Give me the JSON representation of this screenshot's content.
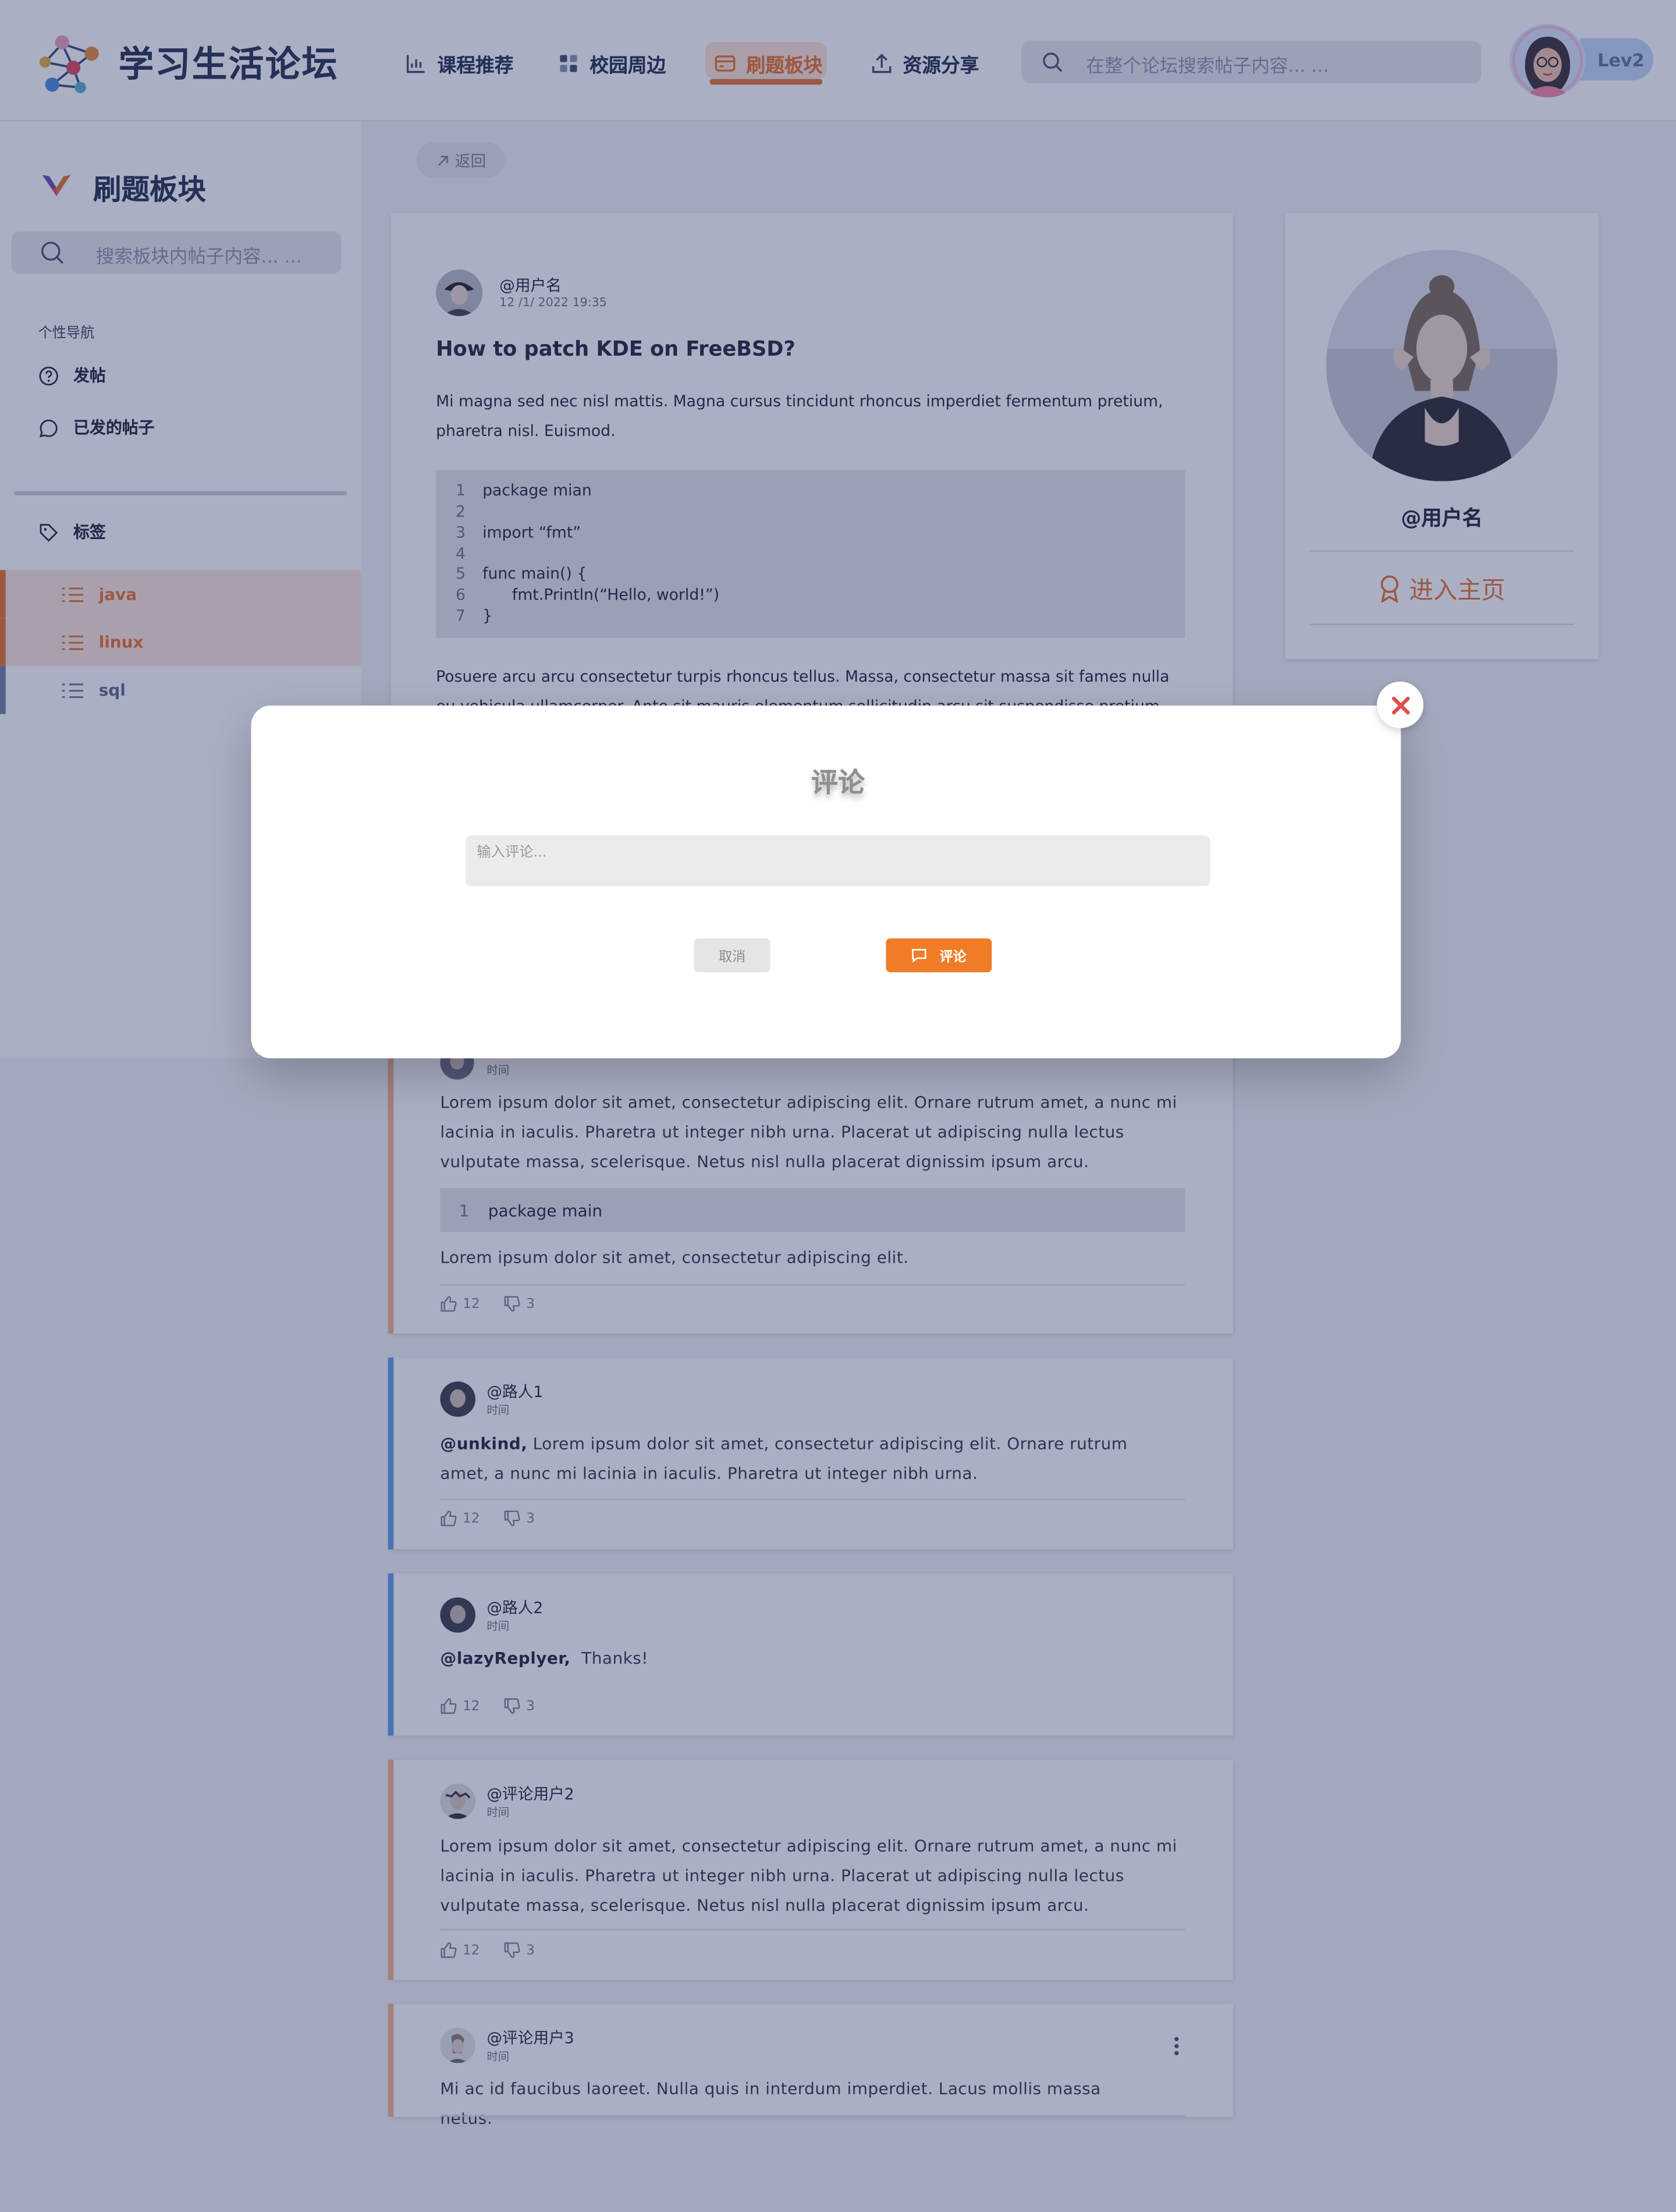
{
  "header": {
    "site_title": "学习生活论坛",
    "nav": [
      {
        "label": "课程推荐",
        "icon": "bar-chart-icon"
      },
      {
        "label": "校园周边",
        "icon": "grid-icon"
      },
      {
        "label": "刷题板块",
        "icon": "card-icon",
        "active": true
      },
      {
        "label": "资源分享",
        "icon": "upload-icon"
      }
    ],
    "search_placeholder": "在整个论坛搜索帖子内容... ...",
    "level_badge": "Lev2"
  },
  "sidebar": {
    "title": "刷题板块",
    "search_placeholder": "搜索板块内帖子内容... ...",
    "nav_label": "个性导航",
    "items": [
      {
        "label": "发帖",
        "icon": "help-circle-icon"
      },
      {
        "label": "已发的帖子",
        "icon": "chat-bubble-icon"
      }
    ],
    "tags_label": "标签",
    "tags": [
      {
        "label": "java",
        "color": "#e9722c"
      },
      {
        "label": "linux",
        "color": "#e9722c"
      },
      {
        "label": "sql",
        "color": "#5a6a8a"
      }
    ]
  },
  "back_label": "返回",
  "post": {
    "author": "@用户名",
    "time": "12 /1/ 2022 19:35",
    "title": "How to patch KDE on FreeBSD?",
    "intro": "Mi magna sed nec nisl mattis. Magna cursus tincidunt rhoncus imperdiet fermentum pretium, pharetra nisl. Euismod.",
    "code": [
      {
        "n": "1",
        "t": "package mian"
      },
      {
        "n": "2",
        "t": ""
      },
      {
        "n": "3",
        "t": "import “fmt”"
      },
      {
        "n": "4",
        "t": ""
      },
      {
        "n": "5",
        "t": "func main() {"
      },
      {
        "n": "6",
        "t": "      fmt.Println(“Hello, world!”)"
      },
      {
        "n": "7",
        "t": "}"
      }
    ],
    "outro": "Posuere arcu arcu consectetur turpis rhoncus tellus. Massa, consectetur massa sit fames nulla eu vehicula ullamcorper. Ante sit mauris elementum sollicitudin arcu sit suspendisse pretium. Nisl egestas"
  },
  "profile": {
    "name": "@用户名",
    "home_label": "进入主页"
  },
  "comments": [
    {
      "time": "时间",
      "text": "Lorem ipsum dolor sit amet, consectetur adipiscing elit. Ornare rutrum amet, a nunc mi lacinia in iaculis. Pharetra ut integer nibh urna. Placerat ut adipiscing nulla lectus vulputate massa, scelerisque. Netus nisl nulla placerat dignissim ipsum arcu.",
      "code_n": "1",
      "code_t": "package main",
      "text2": "Lorem ipsum dolor sit amet, consectetur adipiscing elit.",
      "likes": "12",
      "dislikes": "3"
    },
    {
      "name": "@路人1",
      "time": "时间",
      "mention": "@unkind,",
      "text": " Lorem ipsum dolor sit amet, consectetur adipiscing elit. Ornare rutrum amet, a nunc mi lacinia in iaculis. Pharetra ut integer nibh urna.",
      "likes": "12",
      "dislikes": "3"
    },
    {
      "name": "@路人2",
      "time": "时间",
      "mention": "@lazyReplyer,",
      "text": "  Thanks!",
      "likes": "12",
      "dislikes": "3"
    },
    {
      "name": "@评论用户2",
      "time": "时间",
      "text": "Lorem ipsum dolor sit amet, consectetur adipiscing elit. Ornare rutrum amet, a nunc mi lacinia in iaculis. Pharetra ut integer nibh urna. Placerat ut adipiscing nulla lectus vulputate massa, scelerisque. Netus nisl nulla placerat dignissim ipsum arcu.",
      "likes": "12",
      "dislikes": "3"
    },
    {
      "name": "@评论用户3",
      "time": "时间",
      "text": "Mi ac id faucibus laoreet. Nulla quis in interdum imperdiet. Lacus mollis massa netus."
    }
  ],
  "modal": {
    "title": "评论",
    "input_placeholder": "输入评论...",
    "cancel_label": "取消",
    "submit_label": "评论"
  },
  "colors": {
    "accent": "#e9722c",
    "reply_bar_orange": "#f3b289",
    "reply_bar_blue": "#5c9ee6",
    "overlay": "#27326863"
  }
}
